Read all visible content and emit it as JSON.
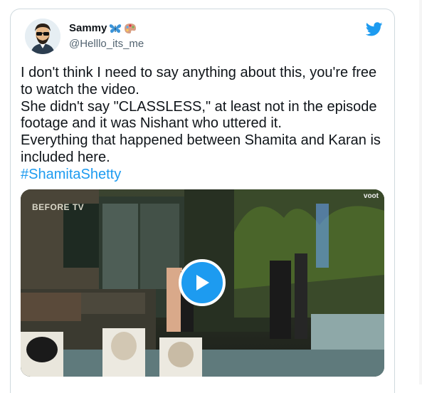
{
  "tweet": {
    "display_name": "Sammy",
    "name_emojis": [
      "butterfly",
      "artist-palette"
    ],
    "handle": "@Helllo_its_me",
    "text": "I don't think I need to say anything about this, you're free to watch the video.\nShe didn't say \"CLASSLESS,\" at least not in the episode footage and it was Nishant who uttered it.\nEverything that happened between Shamita and Karan is included here.",
    "hashtag": "#ShamitaShetty"
  },
  "media": {
    "watermark_left": "BEFORE TV",
    "watermark_right": "voot",
    "play_icon": "play-icon"
  },
  "colors": {
    "accent": "#1d9bf0",
    "text": "#0f1419",
    "secondary_text": "#536471",
    "border": "#cfd9de"
  }
}
